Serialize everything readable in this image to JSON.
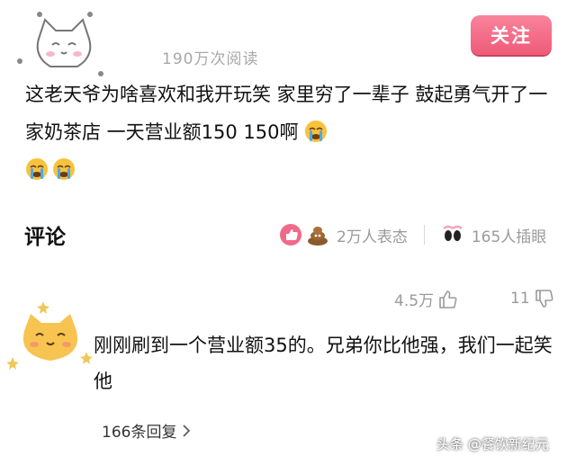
{
  "post": {
    "views": "190万次阅读",
    "follow_label": "关注",
    "text": "这老天爷为啥喜欢和我开玩笑 家里穷了一辈子 鼓起勇气开了一家奶茶店 一天营业额150 150啊",
    "emojis": [
      "crying-face-icon",
      "crying-face-icon",
      "crying-face-icon"
    ]
  },
  "comments_section": {
    "title": "评论",
    "reactions_text": "2万人表态",
    "watch_text": "165人插眼"
  },
  "comment": {
    "likes": "4.5万",
    "dislikes": "11",
    "text": "刚刚刷到一个营业额35的。兄弟你比他强，我们一起笑他",
    "replies": "166条回复"
  },
  "watermark": "头条 @餐饮新纪元",
  "colors": {
    "accent": "#ef5a78",
    "muted": "#9a9a9a",
    "avatar_bg": "#f7c451"
  }
}
